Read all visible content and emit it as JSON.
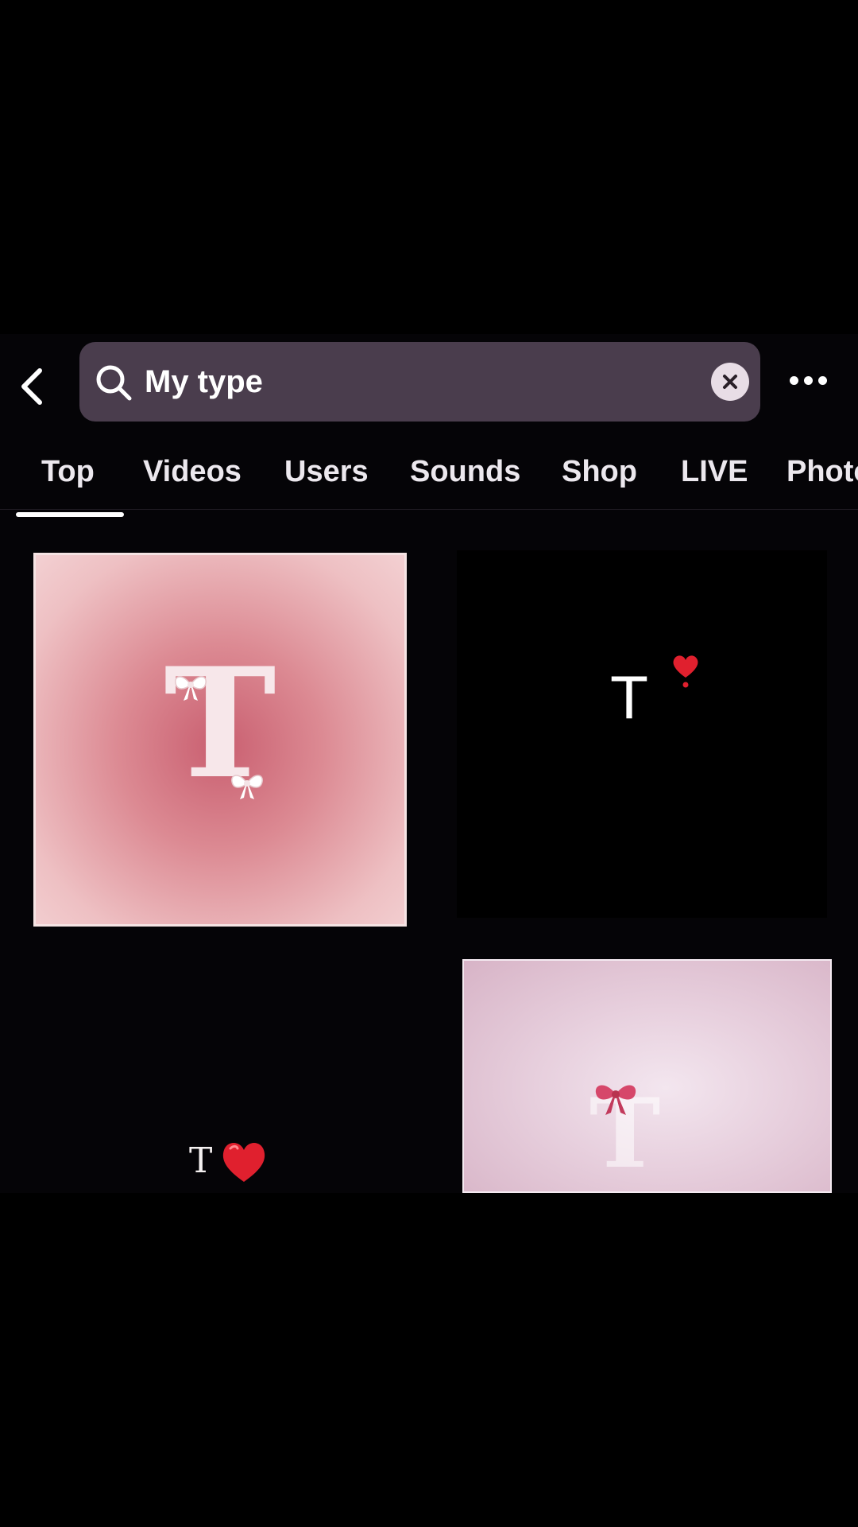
{
  "search": {
    "query": "My type"
  },
  "tabs": [
    {
      "label": "Top",
      "selected": true
    },
    {
      "label": "Videos"
    },
    {
      "label": "Users"
    },
    {
      "label": "Sounds"
    },
    {
      "label": "Shop"
    },
    {
      "label": "LIVE"
    },
    {
      "label": "Photo"
    }
  ],
  "results": [
    {
      "letter": "T",
      "decor": "bow-icon",
      "background": "pink"
    },
    {
      "letter": "T",
      "decor": "heart-icon",
      "background": "black"
    },
    {
      "letter": "T",
      "decor": "heart-icon",
      "background": "black"
    },
    {
      "letter": "T",
      "decor": "bow-icon",
      "background": "light-pink"
    }
  ],
  "icons": {
    "back": "chevron-left-icon",
    "search": "search-icon",
    "clear": "clear-icon",
    "more": "more-icon"
  },
  "colors": {
    "background": "#050407",
    "search_bar": "#4a3d4d",
    "text": "#ffffff",
    "heart": "#e0202e",
    "bow": "#d6476a"
  }
}
